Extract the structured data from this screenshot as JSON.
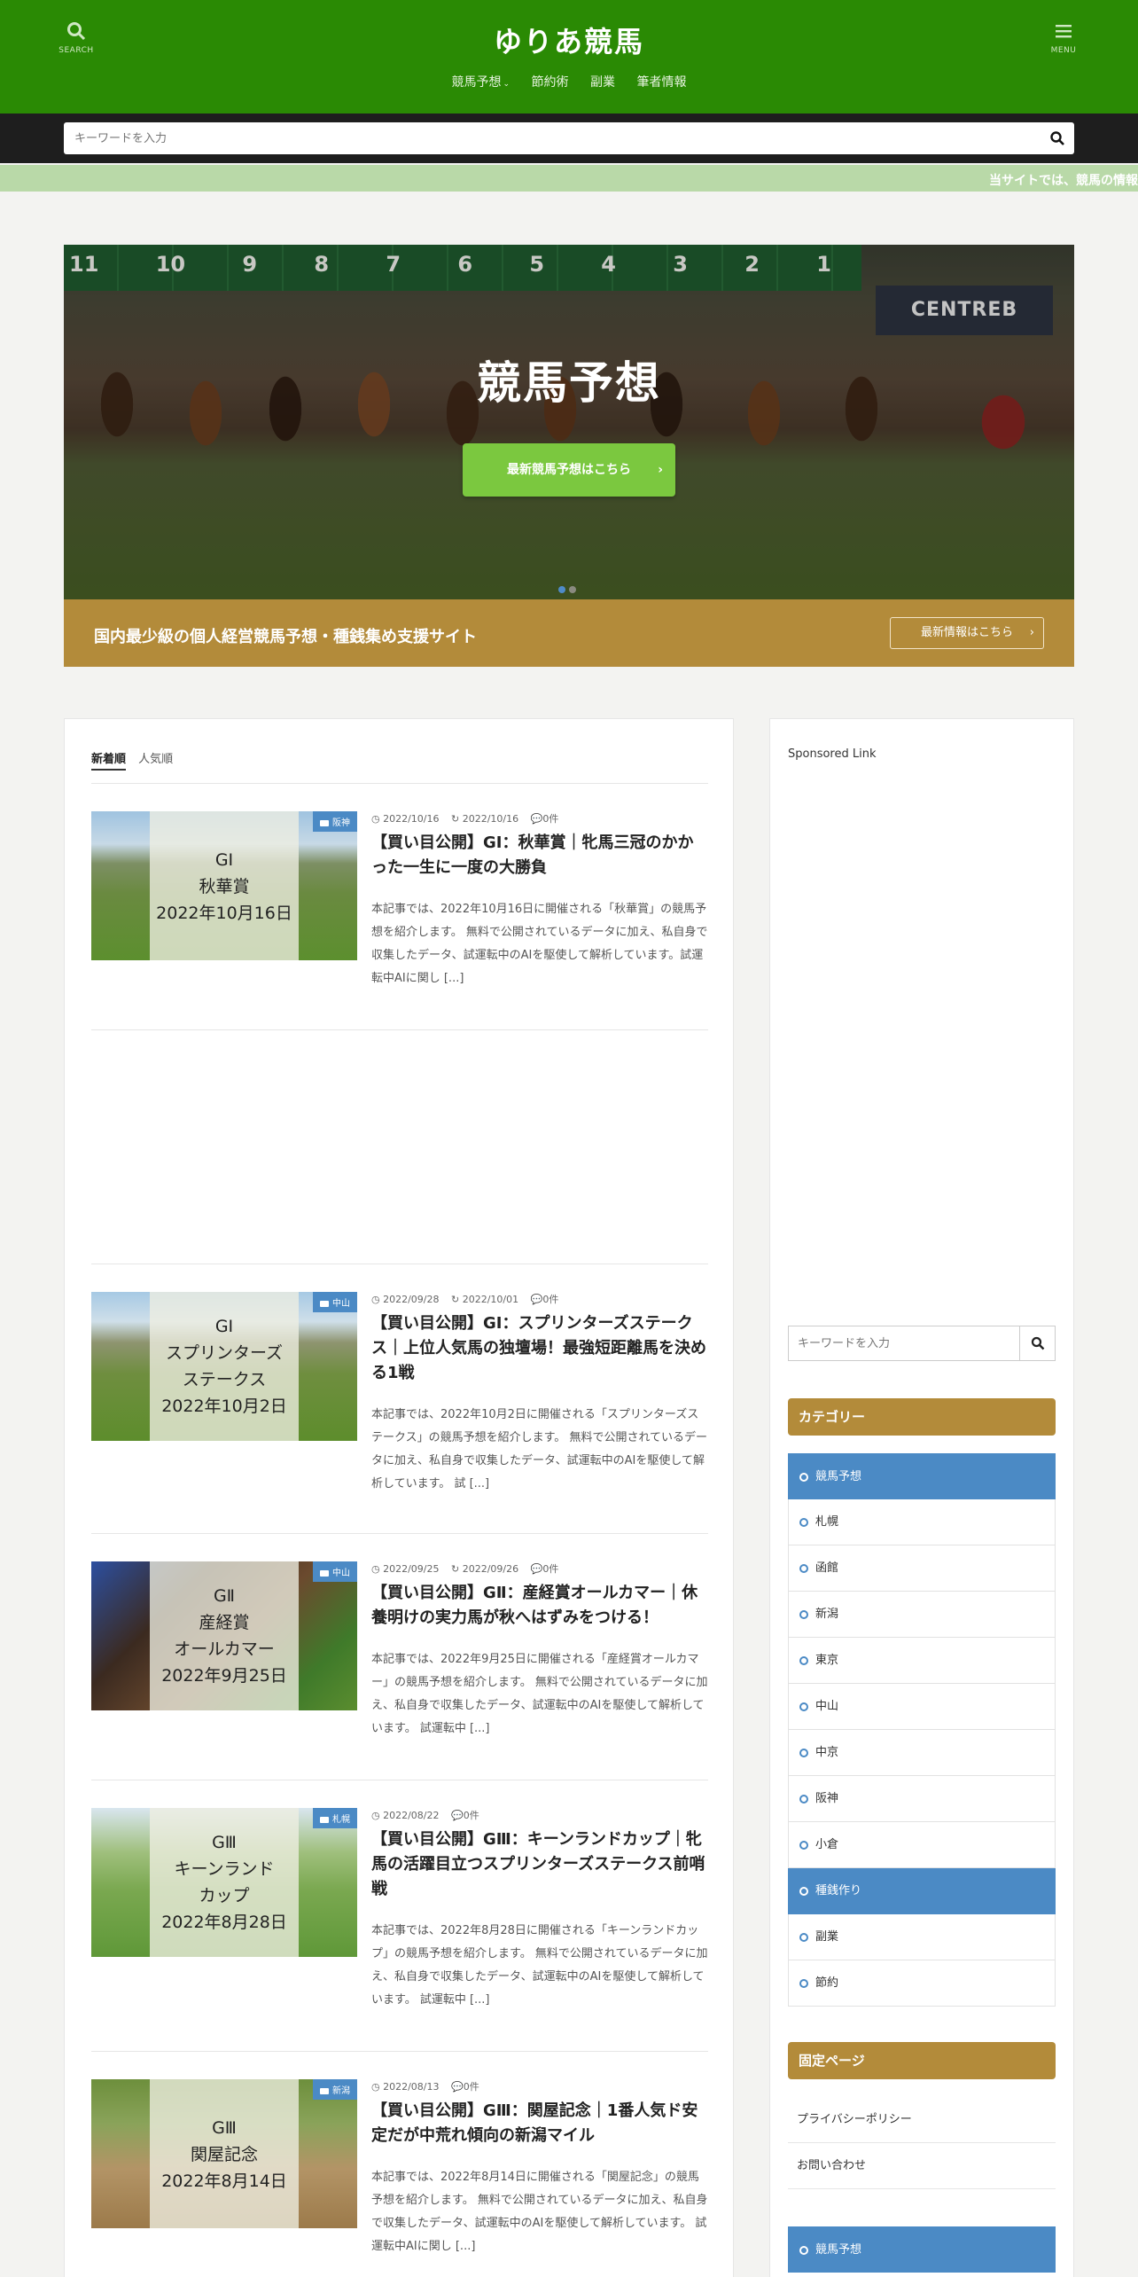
{
  "header": {
    "site_title": "ゆりあ競馬",
    "search_label": "SEARCH",
    "menu_label": "MENU",
    "nav": [
      {
        "label": "競馬予想",
        "has_dropdown": true
      },
      {
        "label": "節約術"
      },
      {
        "label": "副業"
      },
      {
        "label": "筆者情報"
      }
    ],
    "color": "#2a8a04"
  },
  "search": {
    "placeholder": "キーワードを入力"
  },
  "ticker": {
    "text": "当サイトでは、競馬の情報"
  },
  "hero": {
    "gate_numbers": [
      "11",
      "10",
      "9",
      "8",
      "7",
      "6",
      "5",
      "4",
      "3",
      "2",
      "1"
    ],
    "sign_text": "CENTREB",
    "title": "競馬予想",
    "button_label": "最新競馬予想はこちら",
    "band_text": "国内最少級の個人経営競馬予想・種銭集め支援サイト",
    "band_button": "最新情報はこちら"
  },
  "tabs": {
    "new": "新着順",
    "popular": "人気順"
  },
  "posts": [
    {
      "category": "阪神",
      "thumb_lines": [
        "GⅠ",
        "秋華賞",
        "2022年10月16日"
      ],
      "date": "2022/10/16",
      "updated": "2022/10/16",
      "comments": "0件",
      "title": "【買い目公開】GⅠ：秋華賞｜牝馬三冠のかかった一生に一度の大勝負",
      "excerpt": "本記事では、2022年10月16日に開催される「秋華賞」の競馬予想を紹介します。 無料で公開されているデータに加え、私自身で収集したデータ、試運転中のAIを駆使して解析しています。試運転中AIに関し [...]"
    },
    {
      "category": "中山",
      "thumb_lines": [
        "GⅠ",
        "スプリンターズ",
        "ステークス",
        "2022年10月2日"
      ],
      "date": "2022/09/28",
      "updated": "2022/10/01",
      "comments": "0件",
      "title": "【買い目公開】GⅠ：スプリンターズステークス｜上位人気馬の独壇場！最強短距離馬を決める1戦",
      "excerpt": "本記事では、2022年10月2日に開催される「スプリンターズステークス」の競馬予想を紹介します。 無料で公開されているデータに加え、私自身で収集したデータ、試運転中のAIを駆使して解析しています。 試 [...]"
    },
    {
      "category": "中山",
      "thumb_lines": [
        "GⅡ",
        "産経賞",
        "オールカマー",
        "2022年9月25日"
      ],
      "date": "2022/09/25",
      "updated": "2022/09/26",
      "comments": "0件",
      "title": "【買い目公開】GⅡ：産経賞オールカマー｜休養明けの実力馬が秋へはずみをつける！",
      "excerpt": "本記事では、2022年9月25日に開催される「産経賞オールカマー」の競馬予想を紹介します。 無料で公開されているデータに加え、私自身で収集したデータ、試運転中のAIを駆使して解析しています。 試運転中 [...]"
    },
    {
      "category": "札幌",
      "thumb_lines": [
        "GⅢ",
        "キーンランド",
        "カップ",
        "2022年8月28日"
      ],
      "date": "2022/08/22",
      "updated": "",
      "comments": "0件",
      "title": "【買い目公開】GⅢ：キーンランドカップ｜牝馬の活躍目立つスプリンターズステークス前哨戦",
      "excerpt": "本記事では、2022年8月28日に開催される「キーンランドカップ」の競馬予想を紹介します。 無料で公開されているデータに加え、私自身で収集したデータ、試運転中のAIを駆使して解析しています。 試運転中 [...]"
    },
    {
      "category": "新潟",
      "thumb_lines": [
        "GⅢ",
        "関屋記念",
        "2022年8月14日"
      ],
      "date": "2022/08/13",
      "updated": "",
      "comments": "0件",
      "title": "【買い目公開】GⅢ：関屋記念｜1番人気ド安定だが中荒れ傾向の新潟マイル",
      "excerpt": "本記事では、2022年8月14日に開催される「関屋記念」の競馬予想を紹介します。 無料で公開されているデータに加え、私自身で収集したデータ、試運転中のAIを駆使して解析しています。 試運転中AIに関し [...]"
    }
  ],
  "sidebar": {
    "sponsored": "Sponsored Link",
    "search_placeholder": "キーワードを入力",
    "categories_heading": "カテゴリー",
    "categories": [
      {
        "label": "競馬予想",
        "highlight": true
      },
      {
        "label": "札幌"
      },
      {
        "label": "函館"
      },
      {
        "label": "新潟"
      },
      {
        "label": "東京"
      },
      {
        "label": "中山"
      },
      {
        "label": "中京"
      },
      {
        "label": "阪神"
      },
      {
        "label": "小倉"
      },
      {
        "label": "種銭作り",
        "highlight": true
      },
      {
        "label": "副業"
      },
      {
        "label": "節約"
      }
    ],
    "fixed_heading": "固定ページ",
    "fixed_pages": [
      "プライバシーポリシー",
      "お問い合わせ"
    ],
    "bottom_item": "競馬予想"
  },
  "colors": {
    "accent_gold": "#b38b3a",
    "accent_blue": "#4b8ac5",
    "button_green": "#7bc83f"
  }
}
